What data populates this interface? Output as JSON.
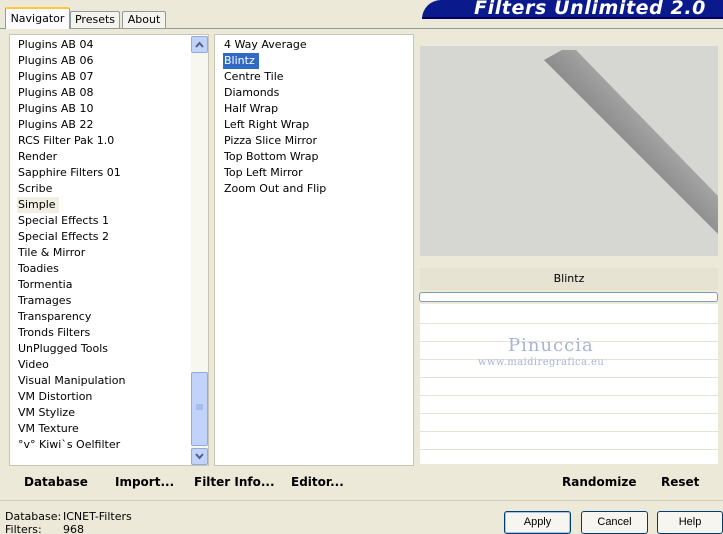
{
  "tabs": [
    {
      "label": "Navigator",
      "active": true
    },
    {
      "label": "Presets",
      "active": false
    },
    {
      "label": "About",
      "active": false
    }
  ],
  "banner": {
    "title": "Filters Unlimited 2.0"
  },
  "categories": [
    "Plugins AB 04",
    "Plugins AB 06",
    "Plugins AB 07",
    "Plugins AB 08",
    "Plugins AB 10",
    "Plugins AB 22",
    "RCS Filter Pak 1.0",
    "Render",
    "Sapphire Filters 01",
    "Scribe",
    "Simple",
    "Special Effects 1",
    "Special Effects 2",
    "Tile & Mirror",
    "Toadies",
    "Tormentia",
    "Tramages",
    "Transparency",
    "Tronds Filters",
    "UnPlugged Tools",
    "Video",
    "Visual Manipulation",
    "VM Distortion",
    "VM Stylize",
    "VM Texture",
    "°v° Kiwi`s Oelfilter"
  ],
  "selected_category": "Simple",
  "filters": [
    "4 Way Average",
    "Blintz",
    "Centre Tile",
    "Diamonds",
    "Half Wrap",
    "Left Right Wrap",
    "Pizza Slice Mirror",
    "Top Bottom Wrap",
    "Top Left Mirror",
    "Zoom Out and Flip"
  ],
  "selected_filter": "Blintz",
  "preview": {
    "filter_name": "Blintz"
  },
  "watermark": {
    "name": "Pinuccia",
    "url": "www.maidiregrafica.eu"
  },
  "actions_left": {
    "database": "Database",
    "import": "Import...",
    "filter_info": "Filter Info...",
    "editor": "Editor..."
  },
  "actions_right": {
    "randomize": "Randomize",
    "reset": "Reset"
  },
  "status": {
    "database_label": "Database:",
    "database_value": "ICNET-Filters",
    "filters_label": "Filters:",
    "filters_value": "968"
  },
  "buttons": {
    "apply": "Apply",
    "cancel": "Cancel",
    "help": "Help"
  },
  "colors": {
    "banner": "#0a1a8c",
    "selection": "#316ac5",
    "panel_bg": "#ece9d8"
  }
}
